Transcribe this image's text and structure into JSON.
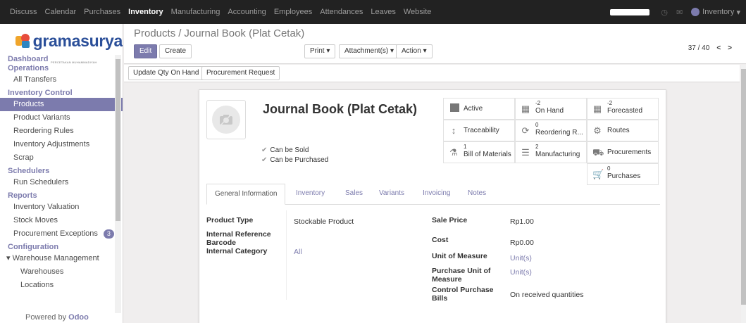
{
  "topbar": {
    "menu": [
      "Discuss",
      "Calendar",
      "Purchases",
      "Inventory",
      "Manufacturing",
      "Accounting",
      "Employees",
      "Attendances",
      "Leaves",
      "Website"
    ],
    "active": "Inventory",
    "user": "Inventory"
  },
  "sidebar": {
    "logo": "gramasurya",
    "logo_sub": "PERCETAKAN MUHAMMADIYAH",
    "dashboard": "Dashboard",
    "operations": "Operations",
    "all_transfers": "All Transfers",
    "inventory_control": "Inventory Control",
    "items_control": [
      "Products",
      "Product Variants",
      "Reordering Rules",
      "Inventory Adjustments",
      "Scrap"
    ],
    "schedulers": "Schedulers",
    "run_schedulers": "Run Schedulers",
    "reports": "Reports",
    "items_reports": [
      "Inventory Valuation",
      "Stock Moves",
      "Procurement Exceptions"
    ],
    "procurement_badge": "3",
    "configuration": "Configuration",
    "warehouse_mgmt": "Warehouse Management",
    "warehouses": "Warehouses",
    "locations": "Locations",
    "powered_prefix": "Powered by",
    "powered_brand": "Odoo"
  },
  "control": {
    "breadcrumb_parent": "Products",
    "breadcrumb_current": "Journal Book (Plat Cetak)",
    "edit": "Edit",
    "create": "Create",
    "print": "Print ▾",
    "attachments": "Attachment(s) ▾",
    "action": "Action ▾",
    "pager": "37 / 40"
  },
  "statusbar": {
    "update_qty": "Update Qty On Hand",
    "procurement_request": "Procurement Request"
  },
  "product": {
    "title": "Journal Book (Plat Cetak)",
    "can_be_sold": "Can be Sold",
    "can_be_purchased": "Can be Purchased"
  },
  "smart_buttons": {
    "active": "Active",
    "on_hand_num": "-2",
    "on_hand": "On Hand",
    "forecasted_num": "-2",
    "forecasted": "Forecasted",
    "traceability": "Traceability",
    "reordering_num": "0",
    "reordering": "Reordering R...",
    "routes": "Routes",
    "bom_num": "1",
    "bom": "Bill of Materials",
    "manufacturing_num": "2",
    "manufacturing": "Manufacturing",
    "procurements": "Procurements",
    "purchases_num": "0",
    "purchases": "Purchases"
  },
  "tabs": [
    "General Information",
    "Inventory",
    "Sales",
    "Variants",
    "Invoicing",
    "Notes"
  ],
  "fields": {
    "product_type_label": "Product Type",
    "product_type": "Stockable Product",
    "internal_ref_label": "Internal Reference",
    "barcode_label": "Barcode",
    "internal_category_label": "Internal Category",
    "internal_category": "All",
    "sale_price_label": "Sale Price",
    "sale_price": "Rp1.00",
    "cost_label": "Cost",
    "cost": "Rp0.00",
    "uom_label": "Unit of Measure",
    "uom": "Unit(s)",
    "purchase_uom_label": "Purchase Unit of Measure",
    "purchase_uom": "Unit(s)",
    "control_purchase_label": "Control Purchase Bills",
    "control_purchase": "On received quantities"
  }
}
